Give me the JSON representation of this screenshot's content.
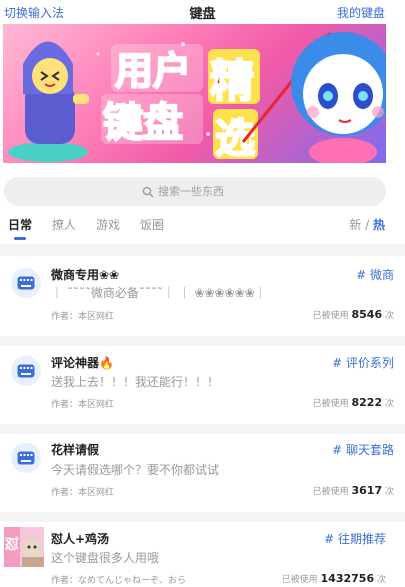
{
  "header": {
    "left_label": "切换输入法",
    "title": "键盘",
    "right_label": "我的键盘"
  },
  "banner": {
    "line1": "用户",
    "line2": "键盘",
    "line3": "精",
    "line4": "选"
  },
  "search": {
    "placeholder": "搜索一些东西"
  },
  "tabs": {
    "items": [
      "日常",
      "撩人",
      "游戏",
      "饭圈"
    ],
    "sort_new": "新",
    "sort_sep": "/",
    "sort_hot": "热"
  },
  "cards": [
    {
      "name": "微商专用❀❀",
      "tag": "# 微商",
      "desc": "｜ ˜˜˜˜微商必备˜˜˜˜｜ ｜ ❀❀❀❀❀❀｜",
      "author": "作者：本区网红",
      "usage_prefix": "已被使用",
      "usage_count": "8546",
      "usage_suffix": "次"
    },
    {
      "name": "评论神器🔥",
      "tag": "# 评价系列",
      "desc": "送我上去！！！我还能行！！！",
      "author": "作者：本区网红",
      "usage_prefix": "已被使用",
      "usage_count": "8222",
      "usage_suffix": "次"
    },
    {
      "name": "花样请假",
      "tag": "# 聊天套路",
      "desc": "今天请假选哪个？要不你都试试",
      "author": "作者：本区网红",
      "usage_prefix": "已被使用",
      "usage_count": "3617",
      "usage_suffix": "次"
    },
    {
      "name": "怼人+鸡汤",
      "tag": "# 往期推荐",
      "desc": "这个键盘很多人用哦",
      "author": "作者：なめてんじゃねーぞ、おら",
      "usage_prefix": "已被使用",
      "usage_count": "1432756",
      "usage_suffix": "次"
    }
  ],
  "colors": {
    "accent": "#3a6fd8",
    "banner_pink": "#f05aa8",
    "banner_red_text": "#e8262c",
    "banner_yellow": "#ffe14d"
  }
}
